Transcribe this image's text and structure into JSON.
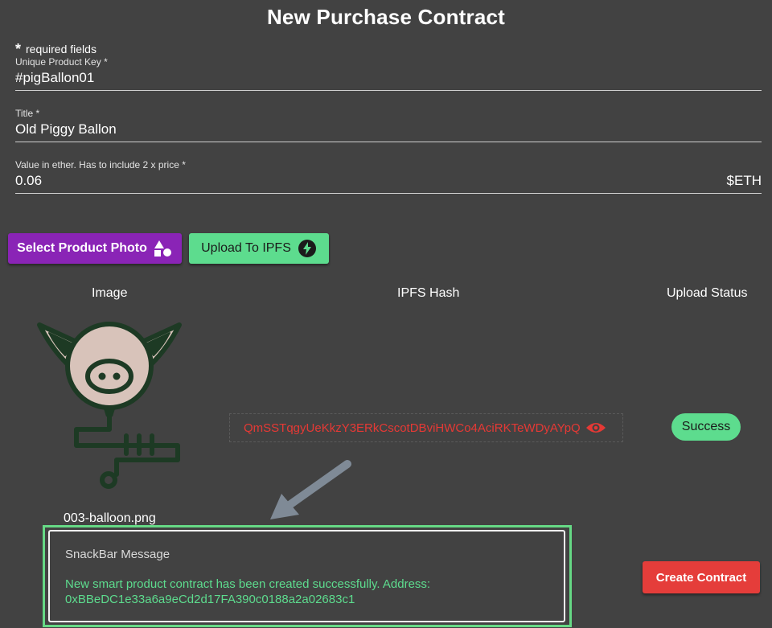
{
  "header": {
    "title": "New Purchase Contract"
  },
  "form": {
    "required_star": "*",
    "required_note": "required fields",
    "product_key": {
      "label": "Unique Product Key *",
      "value": "#pigBallon01"
    },
    "title_field": {
      "label": "Title *",
      "value": "Old Piggy Ballon"
    },
    "value_field": {
      "label": "Value in ether. Has to include 2 x price *",
      "value": "0.06",
      "suffix": "$ETH"
    }
  },
  "actions": {
    "select_photo_label": "Select Product Photo",
    "select_photo_icon": "shapes-icon",
    "upload_label": "Upload To IPFS",
    "upload_icon": "lightning-bolt-icon",
    "create_contract_label": "Create Contract"
  },
  "table": {
    "headers": [
      "Image",
      "IPFS Hash",
      "Upload Status"
    ],
    "row": {
      "image_icon": "pig-balloon-icon",
      "filename": "003-balloon.png",
      "ipfs_hash": "QmSSTqgyUeKkzY3ERkCscotDBviHWCo4AciRKTeWDyAYpQ",
      "hash_icon": "eye-icon",
      "status": "Success"
    }
  },
  "snackbar": {
    "title": "SnackBar Message",
    "message": "New smart product contract has been created successfully. Address: 0xBBeDC1e33a6a9eCd2d17FA390c0188a2a02683c1"
  },
  "colors": {
    "background": "#424242",
    "purple_button": "#8a24b6",
    "green_accent": "#5ddc8e",
    "red_button": "#e53d3a",
    "hash_text": "#e53935"
  }
}
